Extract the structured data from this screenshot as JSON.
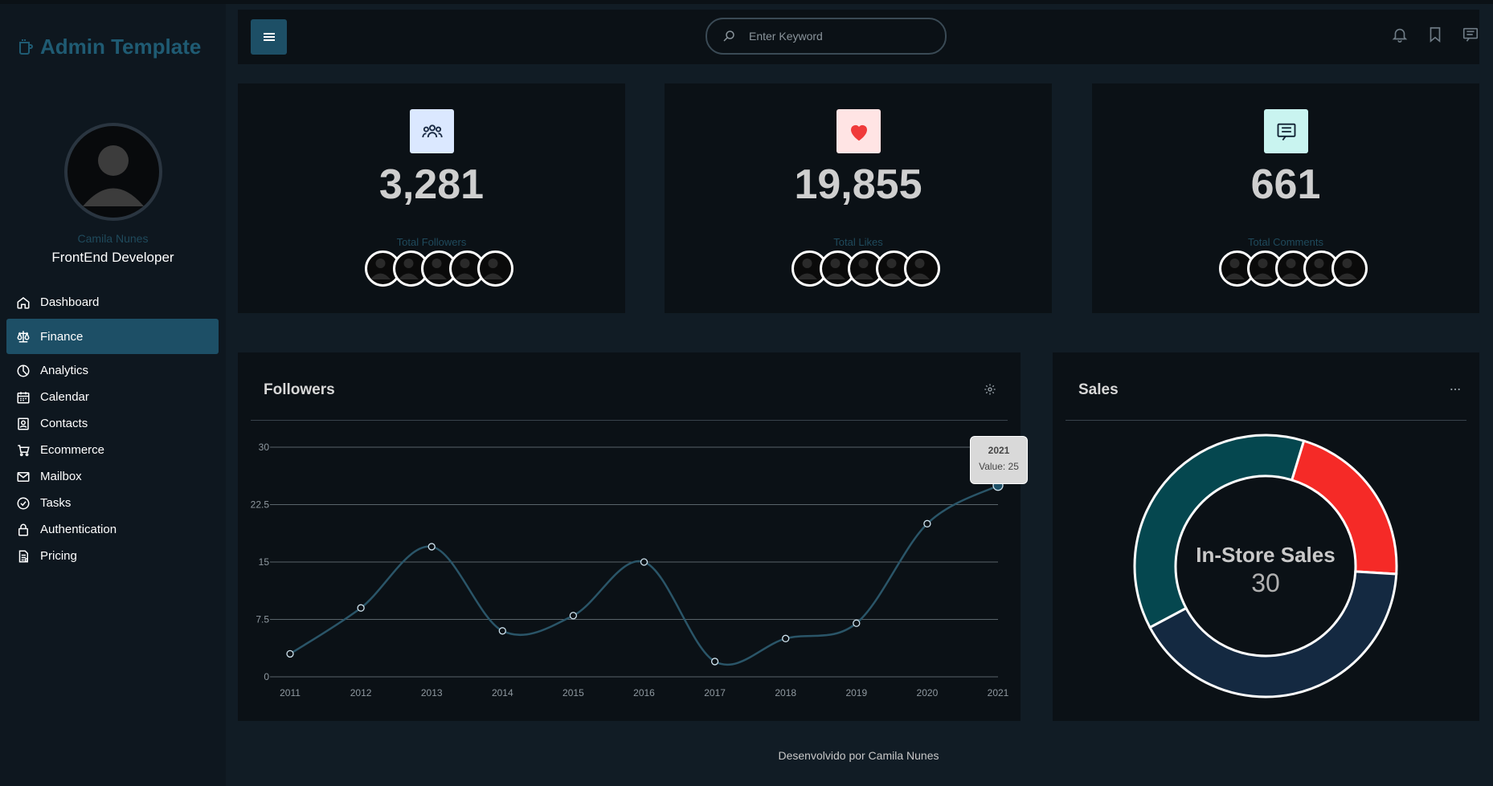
{
  "sidebar": {
    "brand": "Admin Template",
    "profile_name": "Camila Nunes",
    "profile_role": "FrontEnd Developer",
    "items": [
      {
        "label": "Dashboard",
        "icon": "home-icon"
      },
      {
        "label": "Finance",
        "icon": "scale-icon",
        "active": true
      },
      {
        "label": "Analytics",
        "icon": "pie-icon"
      },
      {
        "label": "Calendar",
        "icon": "calendar-icon"
      },
      {
        "label": "Contacts",
        "icon": "contact-icon"
      },
      {
        "label": "Ecommerce",
        "icon": "cart-icon"
      },
      {
        "label": "Mailbox",
        "icon": "mail-icon"
      },
      {
        "label": "Tasks",
        "icon": "check-circle-icon"
      },
      {
        "label": "Authentication",
        "icon": "lock-icon"
      },
      {
        "label": "Pricing",
        "icon": "document-icon"
      }
    ]
  },
  "topbar": {
    "search_placeholder": "Enter Keyword"
  },
  "stats": [
    {
      "value": "3,281",
      "label": "Total Followers",
      "icon": "users-icon",
      "icon_bg": "#dbe8ff"
    },
    {
      "value": "19,855",
      "label": "Total Likes",
      "icon": "heart-icon",
      "icon_bg": "#ffe4e4"
    },
    {
      "value": "661",
      "label": "Total Comments",
      "icon": "comment-icon",
      "icon_bg": "#c9f4f0"
    }
  ],
  "followers_panel": {
    "title": "Followers",
    "tooltip_year": "2021",
    "tooltip_value": "Value: 25"
  },
  "sales_panel": {
    "title": "Sales",
    "center_label": "In-Store Sales",
    "center_value": "30"
  },
  "footer": "Desenvolvido por Camila Nunes",
  "colors": {
    "accent": "#1d4f66",
    "line": "#2a5568",
    "donut_teal": "#05474f",
    "donut_red": "#f52a27",
    "donut_navy": "#142941"
  },
  "chart_data": [
    {
      "type": "line",
      "title": "Followers",
      "x": [
        "2011",
        "2012",
        "2013",
        "2014",
        "2015",
        "2016",
        "2017",
        "2018",
        "2019",
        "2020",
        "2021"
      ],
      "series": [
        {
          "values": [
            3,
            9,
            17,
            6,
            8,
            15,
            2,
            5,
            7,
            20,
            25
          ]
        }
      ],
      "yticks": [
        "0",
        "7.5",
        "15",
        "22.5",
        "30"
      ],
      "ylim": [
        0,
        30
      ],
      "grid": true
    },
    {
      "type": "pie",
      "title": "Sales",
      "donut": true,
      "slices": [
        {
          "name": "In-Store Sales",
          "value": 30,
          "color": "#05474f"
        },
        {
          "name": "",
          "value": 17,
          "color": "#f52a27"
        },
        {
          "name": "",
          "value": 33,
          "color": "#142941"
        }
      ]
    }
  ]
}
